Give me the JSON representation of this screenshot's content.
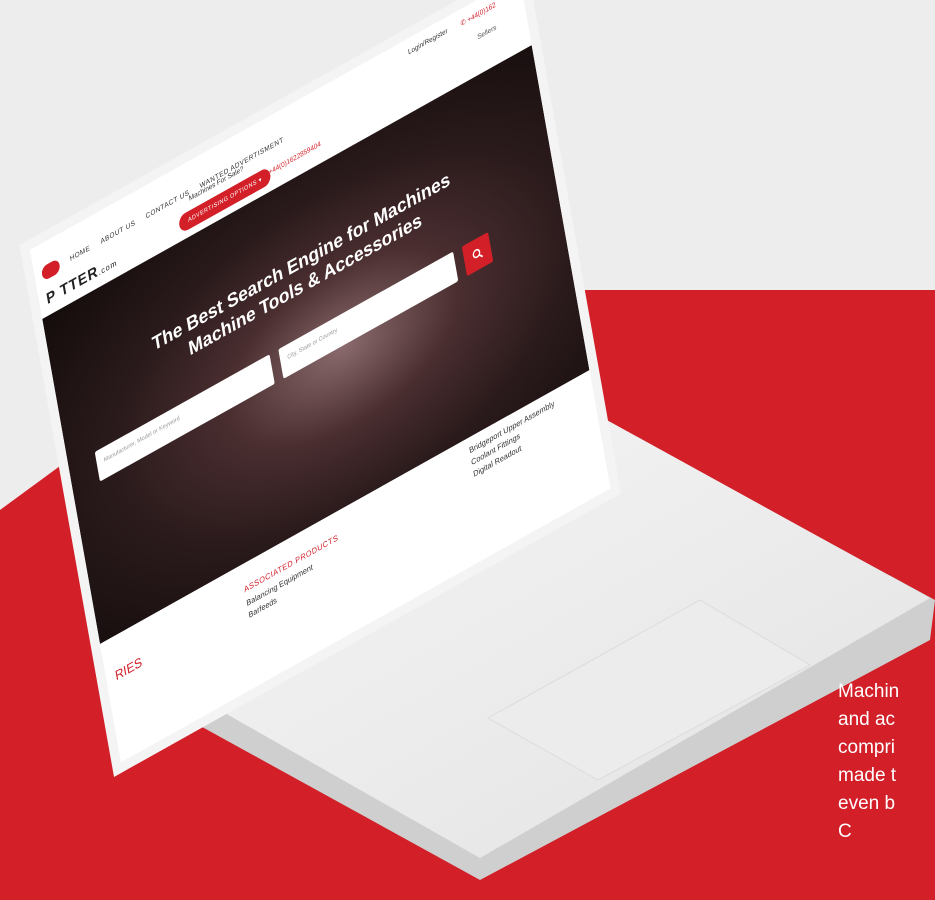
{
  "site": {
    "logo_main": "P TTER",
    "logo_suffix": ".com",
    "nav": [
      "HOME",
      "ABOUT US",
      "CONTACT US",
      "WANTED ADVERTISMENT"
    ],
    "machines_for_sale": "Machines For Sale?",
    "advertising_button": "ADVERTISING OPTIONS",
    "phone": "+44(0)1622859404",
    "phone_top": "+44(0)162",
    "login": "Login/Register",
    "sellers": "Sellers"
  },
  "hero": {
    "title_line1": "The Best Search Engine for Machines",
    "title_line2": "Machine Tools & Accessories",
    "keyword_placeholder": "Manufacturer, Model or Keyword",
    "location_placeholder": "City, State or Country"
  },
  "lower": {
    "categories_fragment": "RIES",
    "associated_title": "ASSOCIATED PRODUCTS",
    "associated_items": [
      "Balancing Equipment",
      "Barfeeds"
    ],
    "right_items": [
      "Bridgeport Upper Assembly",
      "Coolant Fittings",
      "Digital Readout"
    ]
  },
  "caption": {
    "lines": [
      "Machin",
      "and ac",
      "compri",
      "made t",
      "even b",
      "C"
    ]
  },
  "colors": {
    "brand_red": "#d21f28",
    "background": "#ededed"
  }
}
